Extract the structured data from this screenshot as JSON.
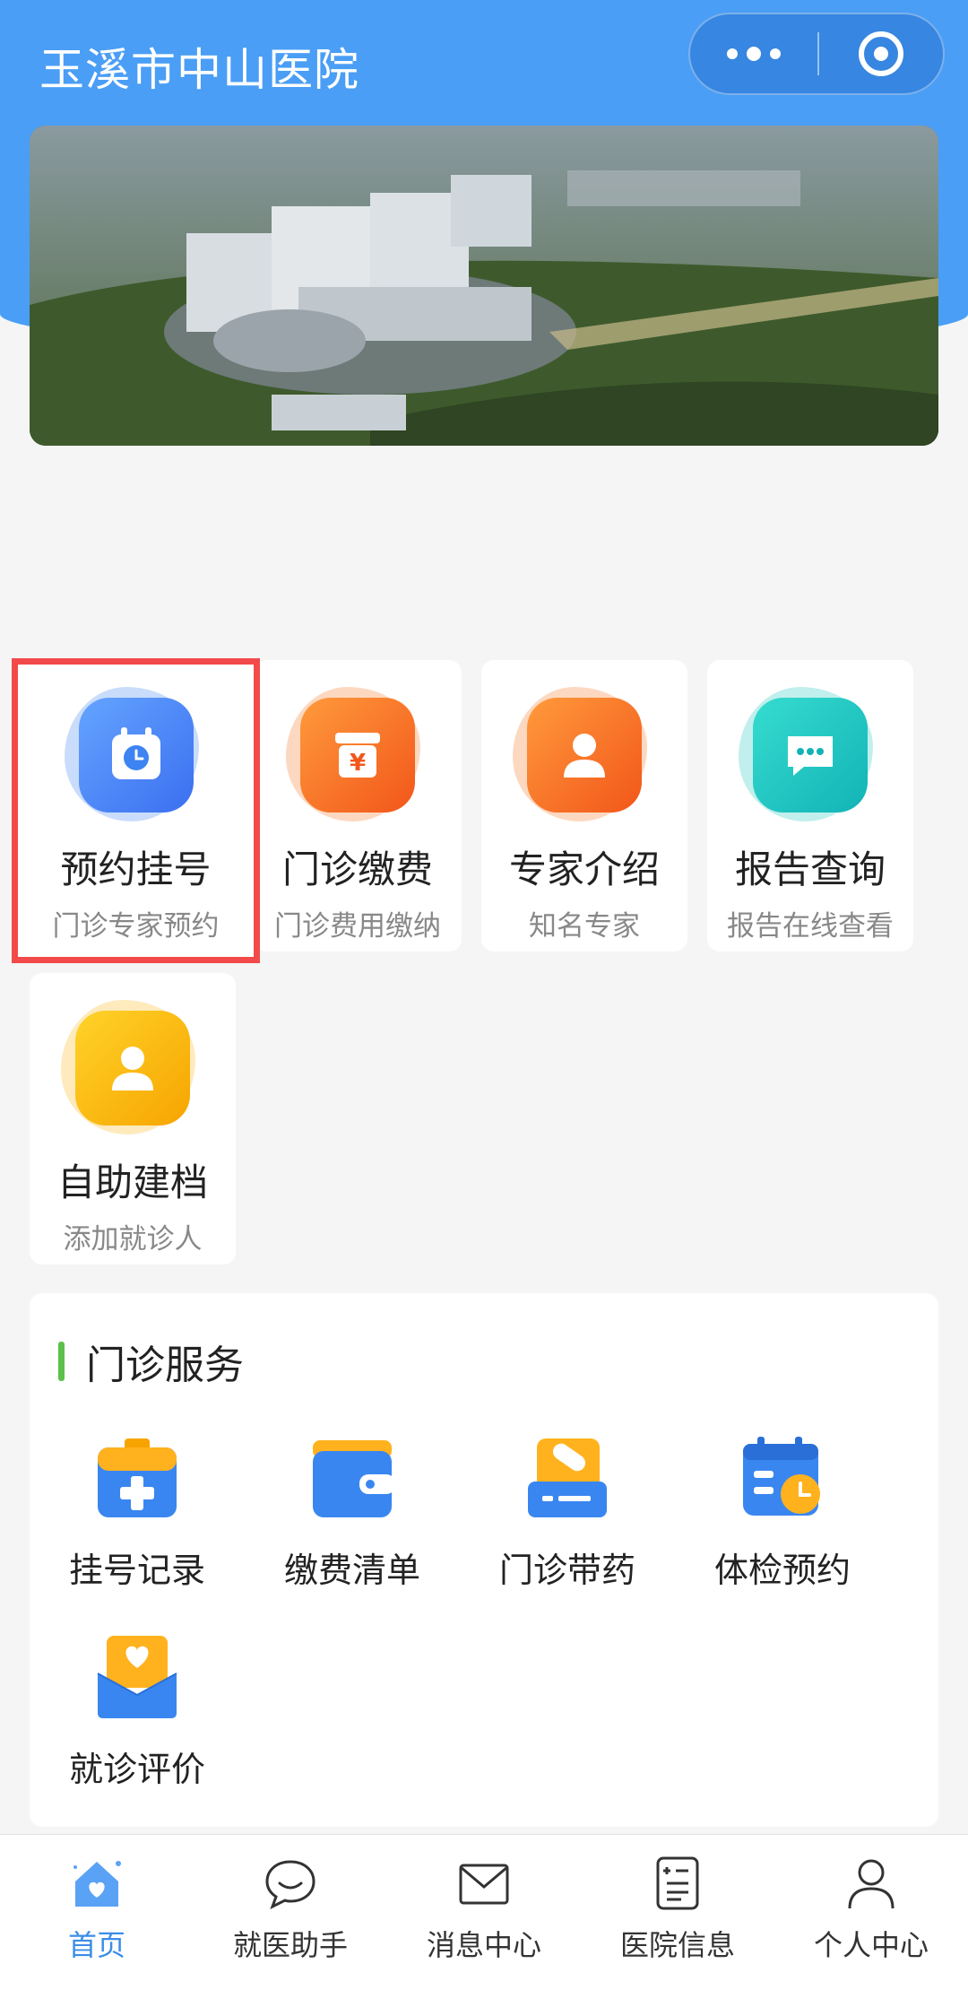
{
  "header": {
    "title": "玉溪市中山医院"
  },
  "quick_services": [
    {
      "title": "预约挂号",
      "subtitle": "门诊专家预约",
      "icon": "calendar-clock-icon",
      "color": "#3d83f2"
    },
    {
      "title": "门诊缴费",
      "subtitle": "门诊费用缴纳",
      "icon": "yen-payment-icon",
      "color": "#f6731d"
    },
    {
      "title": "专家介绍",
      "subtitle": "知名专家",
      "icon": "doctor-avatar-icon",
      "color": "#f6731d"
    },
    {
      "title": "报告查询",
      "subtitle": "报告在线查看",
      "icon": "chat-bubble-icon",
      "color": "#1ec4bd"
    },
    {
      "title": "自助建档",
      "subtitle": "添加就诊人",
      "icon": "person-icon",
      "color": "#fbb40f"
    }
  ],
  "outpatient": {
    "heading": "门诊服务",
    "items": [
      {
        "label": "挂号记录",
        "icon": "medical-kit-icon"
      },
      {
        "label": "缴费清单",
        "icon": "wallet-icon"
      },
      {
        "label": "门诊带药",
        "icon": "medicine-pill-icon"
      },
      {
        "label": "体检预约",
        "icon": "calendar-time-icon"
      },
      {
        "label": "就诊评价",
        "icon": "heart-envelope-icon"
      }
    ]
  },
  "tabbar": [
    {
      "label": "首页",
      "icon": "home-icon",
      "active": true
    },
    {
      "label": "就医助手",
      "icon": "chat-smile-icon",
      "active": false
    },
    {
      "label": "消息中心",
      "icon": "envelope-icon",
      "active": false
    },
    {
      "label": "医院信息",
      "icon": "document-icon",
      "active": false
    },
    {
      "label": "个人中心",
      "icon": "user-icon",
      "active": false
    }
  ],
  "colors": {
    "brand_blue": "#4a9ef5",
    "highlight_red": "#f24a4a",
    "section_accent": "#5cc04a",
    "tab_active": "#3b8de8"
  }
}
